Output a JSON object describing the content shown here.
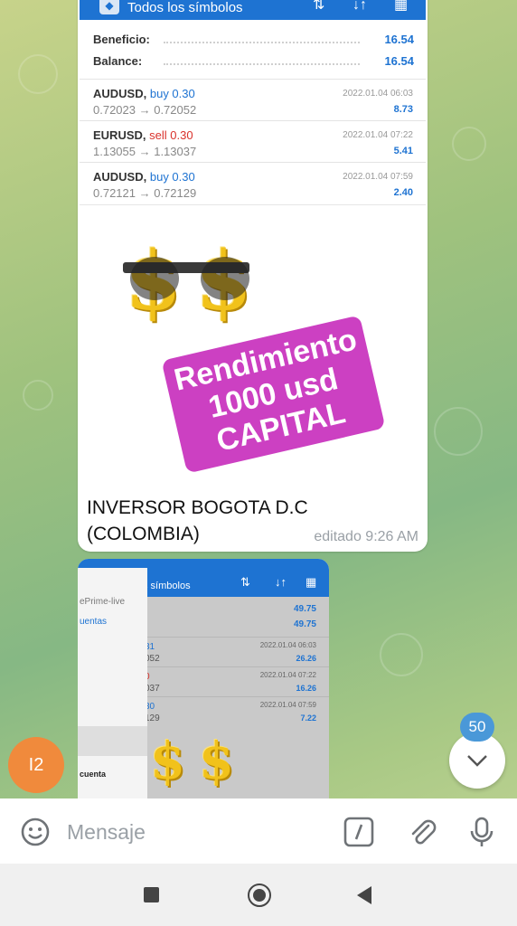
{
  "screenshot": {
    "header_title": "Todos los símbolos",
    "summary": [
      {
        "label": "Beneficio:",
        "value": "16.54"
      },
      {
        "label": "Balance:",
        "value": "16.54"
      }
    ],
    "trades": [
      {
        "symbol": "AUDUSD,",
        "side": "buy 0.30",
        "prices": "0.72023 → 0.72052",
        "date": "2022.01.04 06:03",
        "profit": "8.73",
        "type": "buy"
      },
      {
        "symbol": "EURUSD,",
        "side": "sell 0.30",
        "prices": "1.13055 → 1.13037",
        "date": "2022.01.04 07:22",
        "profit": "5.41",
        "type": "sell"
      },
      {
        "symbol": "AUDUSD,",
        "side": "buy 0.30",
        "prices": "0.72121 → 0.72129",
        "date": "2022.01.04 07:59",
        "profit": "2.40",
        "type": "buy"
      }
    ]
  },
  "promo": {
    "line1": "Rendimiento",
    "line2": "1000 usd",
    "line3": "CAPITAL"
  },
  "dollar_emoji": "$",
  "message1": {
    "caption": "INVERSOR BOGOTA D.C (COLOMBIA)",
    "edited": "editado 9:26 AM"
  },
  "message2": {
    "header_title": "s símbolos",
    "values": [
      "49.75",
      "49.75"
    ],
    "drawer": {
      "item1": "ePrime-live",
      "item2": "uentas",
      "item3": "cuenta"
    },
    "rows": [
      {
        "name": "31",
        "price": "052",
        "date": "2022.01.04 06:03",
        "profit": "26.26",
        "color": "#1e73d2"
      },
      {
        "name": "0",
        "price": "037",
        "date": "2022.01.04 07:22",
        "profit": "16.26",
        "color": "#d9312b"
      },
      {
        "name": "30",
        "price": "129",
        "date": "2022.01.04 07:59",
        "profit": "7.22",
        "color": "#1e73d2"
      }
    ]
  },
  "avatar_initials": "I2",
  "unread_badge": "50",
  "composer": {
    "placeholder": "Mensaje"
  },
  "icons": [
    "emoji-icon",
    "command-icon",
    "attach-icon",
    "mic-icon",
    "chevron-down-icon",
    "nav-recents-icon",
    "nav-home-icon",
    "nav-back-icon"
  ],
  "colors": {
    "accent": "#1e73d2",
    "sell": "#d9312b",
    "promo": "#cc40c2",
    "avatar": "#f08a3c",
    "badge": "#4a98d8"
  }
}
